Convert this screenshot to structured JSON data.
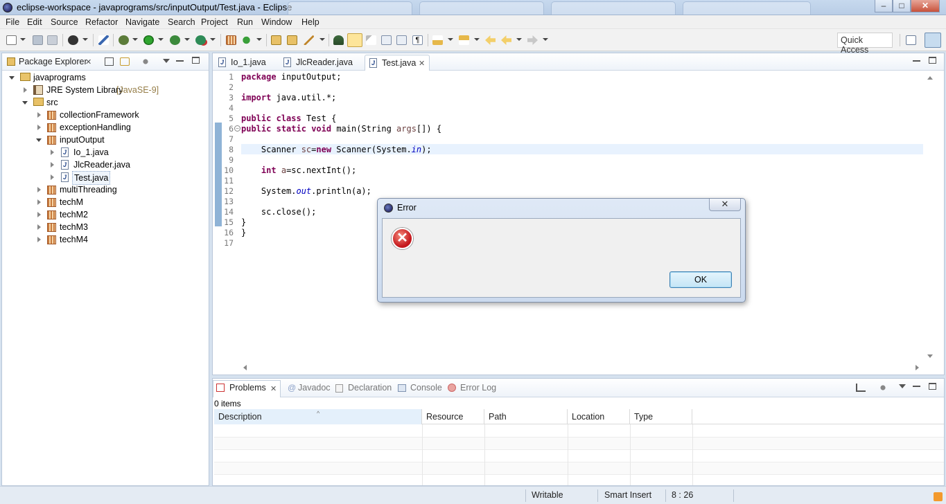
{
  "window": {
    "title": "eclipse-workspace - javaprograms/src/inputOutput/Test.java - Eclipse",
    "minimize": "–",
    "maximize": "□",
    "close": "✕"
  },
  "menu": [
    "File",
    "Edit",
    "Source",
    "Refactor",
    "Navigate",
    "Search",
    "Project",
    "Run",
    "Window",
    "Help"
  ],
  "toolbar": {
    "quick_access": "Quick Access"
  },
  "package_explorer": {
    "title": "Package Explorer",
    "tree": {
      "project": "javaprograms",
      "jre": "JRE System Library",
      "jre_version": "[JavaSE-9]",
      "src": "src",
      "packages": [
        "collectionFramework",
        "exceptionHandling",
        "inputOutput"
      ],
      "files": [
        "Io_1.java",
        "JlcReader.java",
        "Test.java"
      ],
      "packages_after": [
        "multiThreading",
        "techM",
        "techM2",
        "techM3",
        "techM4"
      ]
    }
  },
  "editor": {
    "tabs": [
      {
        "label": "Io_1.java"
      },
      {
        "label": "JlcReader.java"
      },
      {
        "label": "Test.java"
      }
    ],
    "line_numbers": [
      "1",
      "2",
      "3",
      "4",
      "5",
      "6",
      "7",
      "8",
      "9",
      "10",
      "11",
      "12",
      "13",
      "14",
      "15",
      "16",
      "17"
    ],
    "code": {
      "l1_kw": "package",
      "l1_rest": " inputOutput;",
      "l3_kw": "import",
      "l3_rest": " java.util.*;",
      "l5_kw1": "public",
      "l5_kw2": "class",
      "l5_rest": " Test {",
      "l6_kw1": "public",
      "l6_kw2": "static",
      "l6_kw3": "void",
      "l6_rest1": " main(String ",
      "l6_var": "args",
      "l6_rest2": "[]) {",
      "l8_a": "    Scanner ",
      "l8_var": "sc",
      "l8_b": "=",
      "l8_kw": "new",
      "l8_c": " Scanner(System.",
      "l8_fld": "in",
      "l8_d": ");",
      "l10_kw": "int",
      "l10_var": "a",
      "l10_rest": "=sc.nextInt();",
      "l12_a": "    System.",
      "l12_fld": "out",
      "l12_b": ".println(a);",
      "l14": "    sc.close();",
      "l15": "}",
      "l16": "}"
    }
  },
  "problems": {
    "tabs": [
      {
        "label": "Problems"
      },
      {
        "label": "Javadoc"
      },
      {
        "label": "Declaration"
      },
      {
        "label": "Console"
      },
      {
        "label": "Error Log"
      }
    ],
    "count": "0 items",
    "columns": [
      "Description",
      "Resource",
      "Path",
      "Location",
      "Type"
    ]
  },
  "status": {
    "writable": "Writable",
    "insert_mode": "Smart Insert",
    "position": "8 : 26"
  },
  "dialog": {
    "title": "Error",
    "ok": "OK"
  },
  "colors": {
    "keyword": "#7f0055",
    "field": "#0000c0",
    "current_line": "#e8f2fe"
  }
}
